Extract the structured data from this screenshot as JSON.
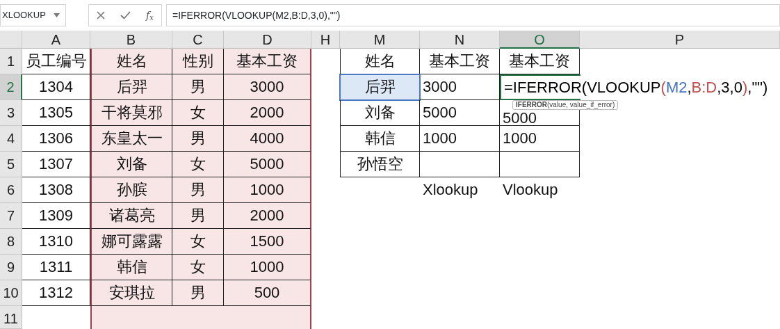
{
  "name_box": {
    "value": "XLOOKUP"
  },
  "formula_bar": {
    "fx": "f$_{x}$",
    "value": "=IFERROR(VLOOKUP(M2,B:D,3,0),\"\")"
  },
  "columns": [
    {
      "label": "A",
      "selected": false
    },
    {
      "label": "B",
      "selected": false
    },
    {
      "label": "C",
      "selected": false
    },
    {
      "label": "D",
      "selected": false
    },
    {
      "label": "H",
      "selected": false
    },
    {
      "label": "M",
      "selected": false
    },
    {
      "label": "N",
      "selected": false
    },
    {
      "label": "O",
      "selected": true
    },
    {
      "label": "P",
      "selected": false
    }
  ],
  "rows": [
    {
      "label": "1",
      "selected": false
    },
    {
      "label": "2",
      "selected": true
    },
    {
      "label": "3",
      "selected": false
    },
    {
      "label": "4",
      "selected": false
    },
    {
      "label": "5",
      "selected": false
    },
    {
      "label": "6",
      "selected": false
    },
    {
      "label": "7",
      "selected": false
    },
    {
      "label": "8",
      "selected": false
    },
    {
      "label": "9",
      "selected": false
    },
    {
      "label": "10",
      "selected": false
    },
    {
      "label": "11",
      "selected": false
    }
  ],
  "employee_table": {
    "header": [
      "员工编号",
      "姓名",
      "性别",
      "基本工资"
    ],
    "rows": [
      [
        "1304",
        "后羿",
        "男",
        "3000"
      ],
      [
        "1305",
        "干将莫邪",
        "女",
        "2000"
      ],
      [
        "1306",
        "东皇太一",
        "男",
        "4000"
      ],
      [
        "1307",
        "刘备",
        "女",
        "5000"
      ],
      [
        "1308",
        "孙膑",
        "男",
        "1000"
      ],
      [
        "1309",
        "诸葛亮",
        "男",
        "2000"
      ],
      [
        "1310",
        "娜可露露",
        "女",
        "1500"
      ],
      [
        "1311",
        "韩信",
        "女",
        "1000"
      ],
      [
        "1312",
        "安琪拉",
        "男",
        "500"
      ]
    ]
  },
  "lookup_table": {
    "header": [
      "姓名",
      "基本工资",
      "基本工资"
    ],
    "rows": [
      {
        "cells": [
          "后羿",
          "3000"
        ],
        "highlighted": true
      },
      {
        "cells": [
          "刘备",
          "5000",
          "5000"
        ],
        "highlighted": false
      },
      {
        "cells": [
          "韩信",
          "1000",
          "1000"
        ],
        "highlighted": false
      },
      {
        "cells": [
          "孙悟空"
        ],
        "highlighted": false
      }
    ],
    "labels_below": [
      "Xlookup",
      "Vlookup"
    ]
  },
  "editing_cell": {
    "segments": [
      {
        "text": "=IFERROR(VLOOKUP",
        "color": "#000000"
      },
      {
        "text": "(",
        "color": "#c0504d"
      },
      {
        "text": "M2",
        "color": "#4472c4"
      },
      {
        "text": ",",
        "color": "#000000"
      },
      {
        "text": "B:D",
        "color": "#c0504d"
      },
      {
        "text": ",3,0",
        "color": "#000000"
      },
      {
        "text": ")",
        "color": "#c0504d"
      },
      {
        "text": ",\"\")",
        "color": "#000000"
      }
    ]
  },
  "tooltip": {
    "function": "IFERROR",
    "args": "(value, value_if_error)"
  }
}
